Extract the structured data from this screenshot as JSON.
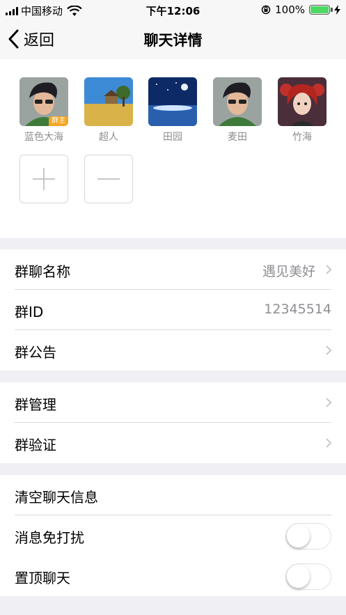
{
  "status_bar": {
    "carrier": "中国移动",
    "time": "下午12:06",
    "battery": "100%",
    "battery_level": 1.0
  },
  "nav": {
    "back_label": "返回",
    "title": "聊天详情"
  },
  "members": [
    {
      "name": "蓝色大海",
      "owner_tag": "群主"
    },
    {
      "name": "超人"
    },
    {
      "name": "田园"
    },
    {
      "name": "麦田"
    },
    {
      "name": "竹海"
    }
  ],
  "settings": {
    "group_name_label": "群聊名称",
    "group_name_value": "遇见美好",
    "group_id_label": "群ID",
    "group_id_value": "12345514",
    "announcement_label": "群公告",
    "management_label": "群管理",
    "verification_label": "群验证",
    "clear_history_label": "清空聊天信息",
    "mute_label": "消息免打扰",
    "mute_on": false,
    "pin_label": "置顶聊天",
    "pin_on": false
  },
  "colors": {
    "background": "#efeff4",
    "secondary_text": "#8e8e93",
    "battery_green": "#4cd964",
    "owner_tag": "#f5a623"
  }
}
